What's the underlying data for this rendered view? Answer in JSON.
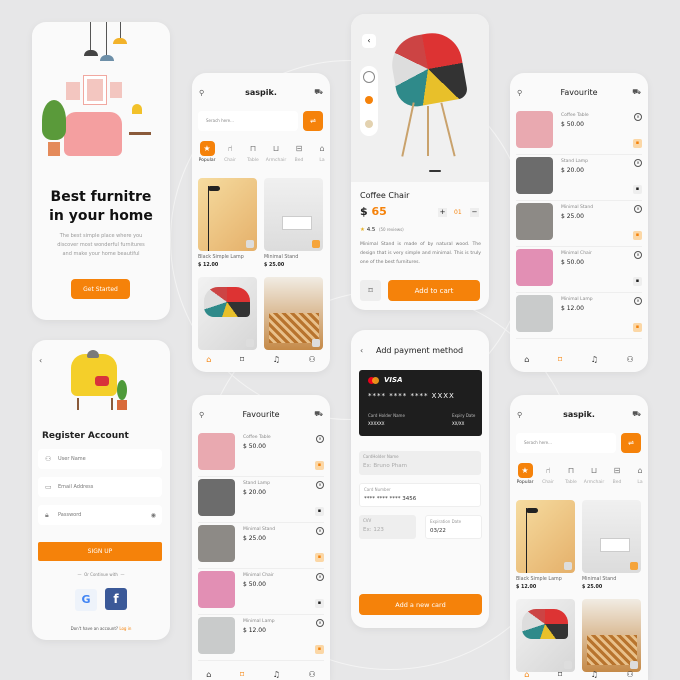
{
  "colors": {
    "accent": "#f5820a",
    "background": "#e7e7e8",
    "card": "#1e1e1e",
    "facebook": "#3b5998"
  },
  "welcome": {
    "title_line1": "Best furnitre",
    "title_line2": "in your home",
    "subtitle_line1": "The best simple place where you",
    "subtitle_line2": "discover most wonderful furnitures",
    "subtitle_line3": "and make your home beautiful",
    "button": "Get Started"
  },
  "register": {
    "title": "Register Account",
    "username_placeholder": "User Name",
    "email_placeholder": "Email Address",
    "password_placeholder": "Password",
    "signup": "SIGN UP",
    "divider": "Or Continue with",
    "footer": "Don't have an account?",
    "login": "Log in"
  },
  "home": {
    "logo": "saspik.",
    "search_placeholder": "Serach here...",
    "categories": [
      "Popular",
      "Chair",
      "Table",
      "Armchair",
      "Bed",
      "La"
    ],
    "category_icons": [
      "star-icon",
      "chair-icon",
      "table-icon",
      "armchair-icon",
      "bed-icon",
      "lamp-icon"
    ],
    "products": [
      {
        "name": "Black Simple Lamp",
        "price": "$ 12.00"
      },
      {
        "name": "Minimal Stand",
        "price": "$ 25.00"
      }
    ]
  },
  "product": {
    "name": "Coffee Chair",
    "currency": "$",
    "price": "65",
    "quantity": "01",
    "rating": "4.5",
    "reviews": "(50 reviews)",
    "description": "Minimal Stand is made of by natural wood. The design that is very simple and minimal. This is truly one of the best furnitures.",
    "add_to_cart": "Add to cart"
  },
  "payment": {
    "title": "Add payment method",
    "card_brand": "VISA",
    "card_number": "**** **** **** XXXX",
    "holder_label": "Card Holder Name",
    "holder_value": "XXXXXX",
    "expiry_label": "Expiry Date",
    "expiry_value": "XX/XX",
    "name_label": "CardHolder Name",
    "name_placeholder": "Ex: Bruno Pham",
    "number_label": "Card Number",
    "number_value": "**** **** **** 3456",
    "cvv_label": "CVV",
    "cvv_placeholder": "Ex: 123",
    "exp_label": "Expiration Date",
    "exp_value": "03/22",
    "button": "Add a new card"
  },
  "favourite": {
    "title": "Favourite",
    "items": [
      {
        "name": "Coffee Table",
        "price": "$ 50.00",
        "color": "#e9a9b0"
      },
      {
        "name": "Stand Lamp",
        "price": "$ 20.00",
        "color": "#6c6c6c"
      },
      {
        "name": "Minimal Stand",
        "price": "$ 25.00",
        "color": "#8d8a86"
      },
      {
        "name": "Minimal Chair",
        "price": "$ 50.00",
        "color": "#e28fb4"
      },
      {
        "name": "Minimal Lamp",
        "price": "$ 12.00",
        "color": "#c9cbcb"
      }
    ]
  }
}
